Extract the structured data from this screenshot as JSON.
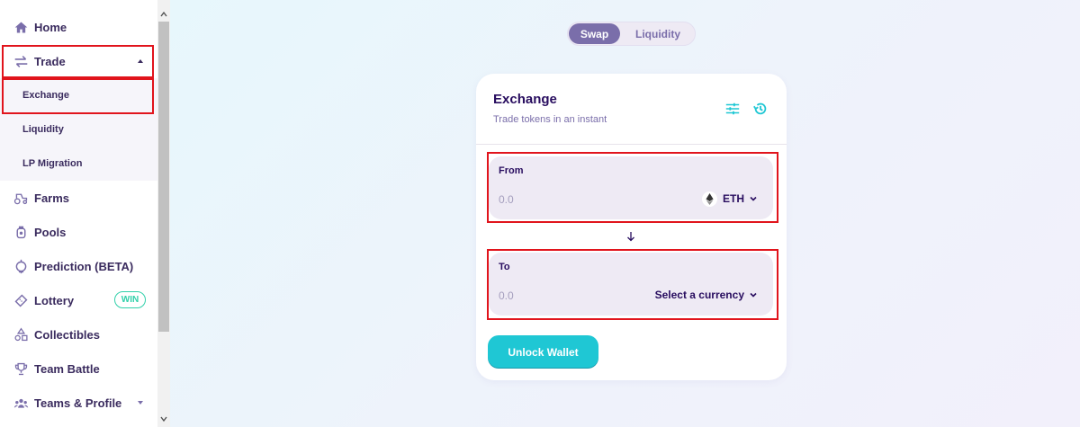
{
  "sidebar": {
    "home": "Home",
    "trade": "Trade",
    "trade_sub": [
      "Exchange",
      "Liquidity",
      "LP Migration"
    ],
    "farms": "Farms",
    "pools": "Pools",
    "prediction": "Prediction (BETA)",
    "lottery": "Lottery",
    "lottery_badge": "WIN",
    "collectibles": "Collectibles",
    "team_battle": "Team Battle",
    "teams_profile": "Teams & Profile"
  },
  "toggle": {
    "swap": "Swap",
    "liquidity": "Liquidity"
  },
  "card": {
    "title": "Exchange",
    "subtitle": "Trade tokens in an instant",
    "from": {
      "label": "From",
      "placeholder": "0.0",
      "currency": "ETH"
    },
    "arrow": "↓",
    "to": {
      "label": "To",
      "placeholder": "0.0",
      "currency": "Select a currency"
    },
    "button": "Unlock Wallet"
  },
  "colors": {
    "primary": "#1fc7d4",
    "text": "#280d5f",
    "secondary": "#7a6eaa",
    "success": "#31d0aa",
    "input_bg": "#eeeaf4",
    "highlight_border": "#e1141c"
  },
  "icons": {
    "home": "home-icon",
    "trade": "trade-icon",
    "farms": "tractor-icon",
    "pools": "pool-icon",
    "prediction": "prediction-icon",
    "lottery": "ticket-icon",
    "collectibles": "shapes-icon",
    "team_battle": "trophy-icon",
    "teams_profile": "group-icon",
    "settings": "tune-icon",
    "history": "history-icon",
    "eth": "eth-icon"
  }
}
